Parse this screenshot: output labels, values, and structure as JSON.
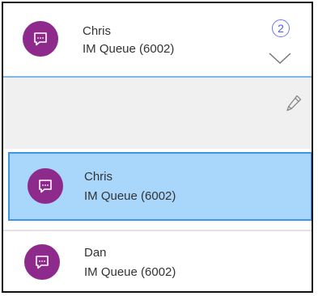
{
  "active_conversation": {
    "name": "Chris",
    "queue": "IM Queue (6002)",
    "badge_count": "2",
    "avatar_color": "#8e2a8b",
    "icon": "chat-icon",
    "expand_icon": "chevron-down-icon"
  },
  "toolbar": {
    "edit_icon": "pencil-icon"
  },
  "conversations": [
    {
      "name": "Chris",
      "queue": "IM Queue (6002)",
      "selected": true,
      "icon": "chat-icon"
    },
    {
      "name": "Dan",
      "queue": "IM Queue (6002)",
      "selected": false,
      "icon": "chat-icon"
    }
  ],
  "colors": {
    "avatar": "#8e2a8b",
    "selected_row_bg": "#a9d6fb",
    "selected_row_border": "#3b96e6",
    "badge": "#4c5de8",
    "header_divider": "#7fb7e6"
  }
}
